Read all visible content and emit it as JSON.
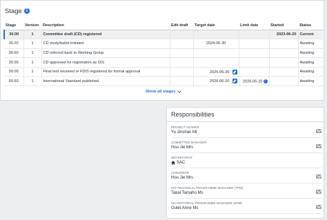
{
  "stage": {
    "title": "Stage",
    "columns": [
      "Stage",
      "Version",
      "Description",
      "Edit draft",
      "Target date",
      "Limit date",
      "Started",
      "Status"
    ],
    "rows": [
      {
        "stage": "30.00",
        "version": "1",
        "description": "Committee draft (CD) registered",
        "edit_draft": "",
        "target_date": "",
        "limit_date": "",
        "started": "2023-06-20",
        "status": "Current",
        "current": true
      },
      {
        "stage": "30.20",
        "version": "1",
        "description": "CD study/ballot initiated",
        "edit_draft": "",
        "target_date": "2024-06-30",
        "limit_date": "",
        "started": "",
        "status": "Awaiting"
      },
      {
        "stage": "30.60",
        "version": "1",
        "description": "CD referred back to Working Group",
        "edit_draft": "",
        "target_date": "",
        "limit_date": "",
        "started": "",
        "status": "Awaiting"
      },
      {
        "stage": "30.99",
        "version": "1",
        "description": "CD approved for registration as DIS",
        "edit_draft": "",
        "target_date": "",
        "limit_date": "",
        "started": "",
        "status": "Awaiting"
      },
      {
        "stage": "50.00",
        "version": "1",
        "description": "Final text received or FDIS registered for formal approval",
        "edit_draft": "",
        "target_date": "2025-06-30",
        "limit_date": "",
        "started": "",
        "status": "Awaiting"
      },
      {
        "stage": "60.60",
        "version": "1",
        "description": "International Standard published",
        "edit_draft": "",
        "target_date": "2026-06-20",
        "limit_date": "2026-06-20",
        "started": "",
        "status": "Awaiting"
      }
    ],
    "show_all_label": "Show all stages"
  },
  "responsibilities": {
    "title": "Responsibilities",
    "items": [
      {
        "label": "Project leader",
        "value": "Yu Jinshan Mr"
      },
      {
        "label": "Committee manager",
        "value": "Hou Jie Mrs"
      },
      {
        "label": "Secretariat",
        "value": "SAC"
      },
      {
        "label": "Convenor",
        "value": "Hou Jie Mrs"
      },
      {
        "label": "ISO Technical Programme Manager (TPM)",
        "value": "Takal Tamaho Ms"
      },
      {
        "label": "ISO Editorial Programme Manager (EPM)",
        "value": "Gulet Anne Ms"
      }
    ]
  },
  "colors": {
    "accent": "#1d6fd6",
    "background": "#eceeef",
    "card": "#ffffff"
  }
}
